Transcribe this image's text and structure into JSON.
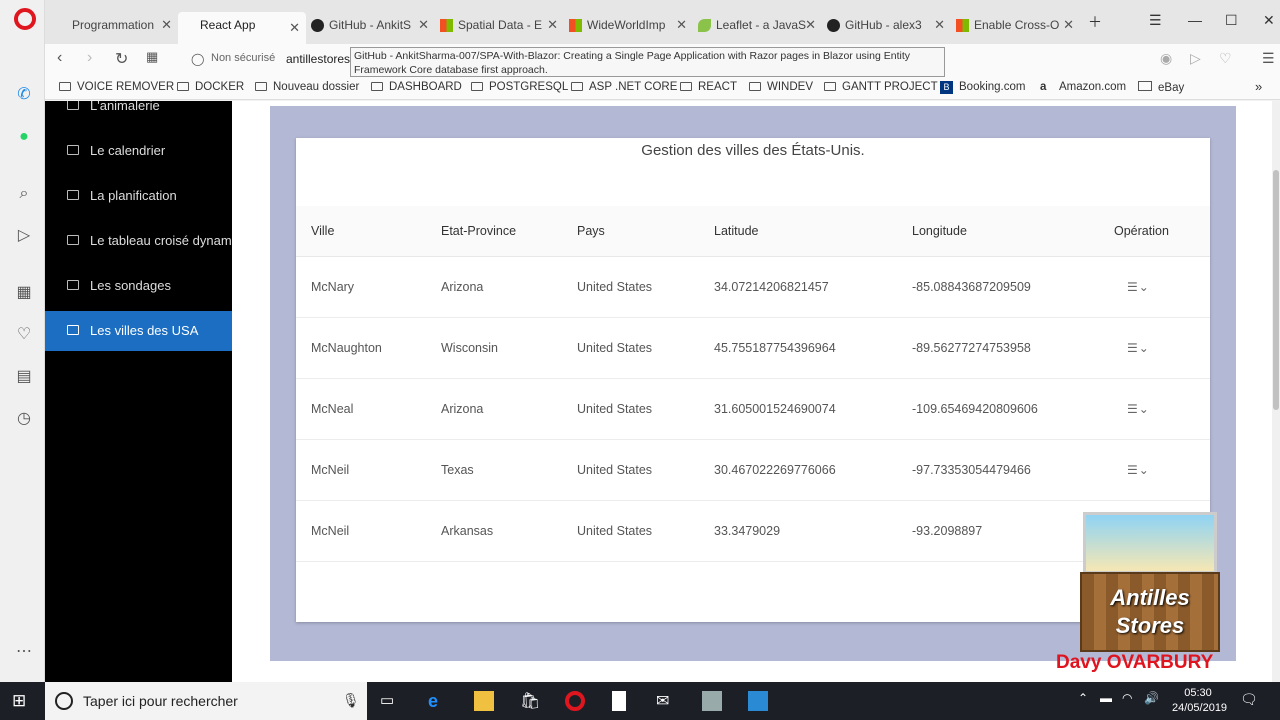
{
  "browser": {
    "tabs": [
      {
        "label": "Programmation",
        "favicon": "none"
      },
      {
        "label": "React App",
        "favicon": "none",
        "active": true
      },
      {
        "label": "GitHub - AnkitS",
        "favicon": "github-icon"
      },
      {
        "label": "Spatial Data - E",
        "favicon": "microsoft-icon"
      },
      {
        "label": "WideWorldImp",
        "favicon": "microsoft-icon"
      },
      {
        "label": "Leaflet - a JavaS",
        "favicon": "leaf-icon"
      },
      {
        "label": "GitHub - alex3",
        "favicon": "github-icon"
      },
      {
        "label": "Enable Cross-O",
        "favicon": "microsoft-icon"
      }
    ],
    "security_label": "Non sécurisé",
    "url": "antillestores",
    "tooltip": "GitHub - AnkitSharma-007/SPA-With-Blazor: Creating a Single Page Application with Razor pages in Blazor using Entity Framework Core database first approach.",
    "bookmarks": [
      {
        "label": "VOICE REMOVER"
      },
      {
        "label": "DOCKER"
      },
      {
        "label": "Nouveau dossier"
      },
      {
        "label": "DASHBOARD"
      },
      {
        "label": "POSTGRESQL"
      },
      {
        "label": "ASP .NET CORE"
      },
      {
        "label": "REACT"
      },
      {
        "label": "WINDEV"
      },
      {
        "label": "GANTT PROJECT"
      },
      {
        "label": "Booking.com"
      },
      {
        "label": "Amazon.com"
      },
      {
        "label": "eBay"
      }
    ]
  },
  "sidebar": {
    "items": [
      {
        "label": "L'animalerie"
      },
      {
        "label": "Le calendrier"
      },
      {
        "label": "La planification"
      },
      {
        "label": "Le tableau croisé dynamique"
      },
      {
        "label": "Les sondages"
      },
      {
        "label": "Les villes des USA",
        "active": true
      }
    ]
  },
  "main": {
    "title": "Gestion des villes des États-Unis.",
    "columns": [
      "Ville",
      "Etat-Province",
      "Pays",
      "Latitude",
      "Longitude",
      "Opération"
    ],
    "rows": [
      [
        "McNary",
        "Arizona",
        "United States",
        "34.07214206821457",
        "-85.08843687209509"
      ],
      [
        "McNaughton",
        "Wisconsin",
        "United States",
        "45.755187754396964",
        "-89.56277274753958"
      ],
      [
        "McNeal",
        "Arizona",
        "United States",
        "31.605001524690074",
        "-109.65469420809606"
      ],
      [
        "McNeil",
        "Texas",
        "United States",
        "30.467022269776066",
        "-97.73353054479466"
      ],
      [
        "McNeil",
        "Arkansas",
        "United States",
        "33.3479029",
        "-93.2098897"
      ]
    ]
  },
  "watermark": {
    "logo_text": "Antilles Stores",
    "signature": "Davy OVARBURY"
  },
  "taskbar": {
    "search_placeholder": "Taper ici pour rechercher",
    "time": "05:30",
    "date": "24/05/2019"
  },
  "colors": {
    "accent": "#1b6ec2",
    "opera_red": "#e0161e",
    "panel_bg": "#b3b8d4"
  }
}
